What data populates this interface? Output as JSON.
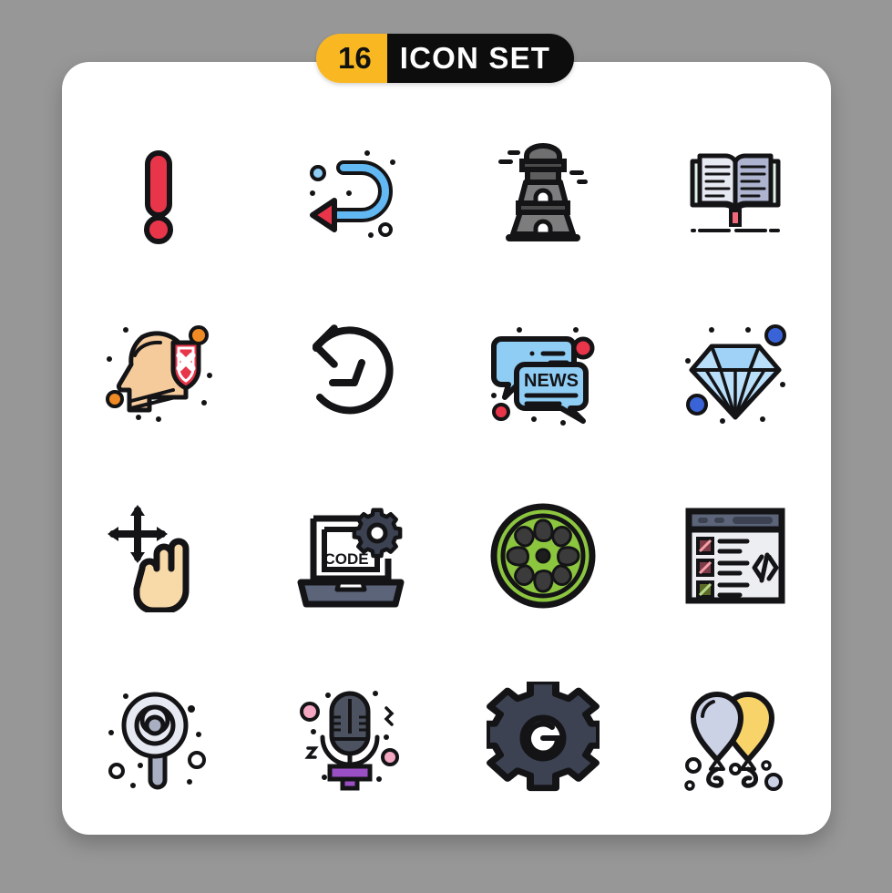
{
  "page": {
    "background_color": "#979797",
    "card_color": "#ffffff"
  },
  "header": {
    "count": "16",
    "title": "ICON SET",
    "count_bg": "#f9b722",
    "title_bg": "#0d0d0d",
    "count_text_color": "#111111",
    "title_text_color": "#ffffff"
  },
  "palette": {
    "outline": "#141417",
    "red": "#e8354a",
    "red_deep": "#d93345",
    "blue_light": "#8fcdf5",
    "blue_accent": "#3a63d8",
    "gray_dark": "#3c4251",
    "gray_mid": "#7d7d7d",
    "gray_light": "#c9cddb",
    "skin": "#f6cb9c",
    "green": "#8cc63f",
    "yellow": "#f7d36a",
    "purple": "#9b4fc4",
    "orange": "#f08a24",
    "pink": "#f4a7c0",
    "mint": "#dff0ea",
    "lavender": "#aeb4cf"
  },
  "icons": [
    {
      "row": 1,
      "col": 1,
      "name": "exclamation-mark-icon",
      "label": "Exclamation Mark"
    },
    {
      "row": 1,
      "col": 2,
      "name": "undo-arrow-icon",
      "label": "Undo Arrow"
    },
    {
      "row": 1,
      "col": 3,
      "name": "lighthouse-tower-icon",
      "label": "Lighthouse Tower"
    },
    {
      "row": 1,
      "col": 4,
      "name": "open-book-icon",
      "label": "Open Book"
    },
    {
      "row": 2,
      "col": 1,
      "name": "head-shield-block-icon",
      "label": "Head Shield Block"
    },
    {
      "row": 2,
      "col": 2,
      "name": "history-clock-icon",
      "label": "History Clock"
    },
    {
      "row": 2,
      "col": 3,
      "name": "news-chat-icon",
      "label": "News Chat"
    },
    {
      "row": 2,
      "col": 4,
      "name": "diamond-icon",
      "label": "Diamond"
    },
    {
      "row": 3,
      "col": 1,
      "name": "drag-gesture-hand-icon",
      "label": "Drag Gesture Hand"
    },
    {
      "row": 3,
      "col": 2,
      "name": "laptop-code-gear-icon",
      "label": "Laptop Code Gear"
    },
    {
      "row": 3,
      "col": 3,
      "name": "lime-slice-icon",
      "label": "Lime Slice"
    },
    {
      "row": 3,
      "col": 4,
      "name": "browser-code-list-icon",
      "label": "Browser Code List"
    },
    {
      "row": 4,
      "col": 1,
      "name": "lollipop-spiral-icon",
      "label": "Lollipop Spiral"
    },
    {
      "row": 4,
      "col": 2,
      "name": "microphone-icon",
      "label": "Microphone"
    },
    {
      "row": 4,
      "col": 3,
      "name": "gear-settings-icon",
      "label": "Gear Settings"
    },
    {
      "row": 4,
      "col": 4,
      "name": "balloons-icon",
      "label": "Balloons"
    }
  ],
  "icon_text": {
    "news": "NEWS",
    "code": "CODE",
    "code_brackets": "</>"
  }
}
